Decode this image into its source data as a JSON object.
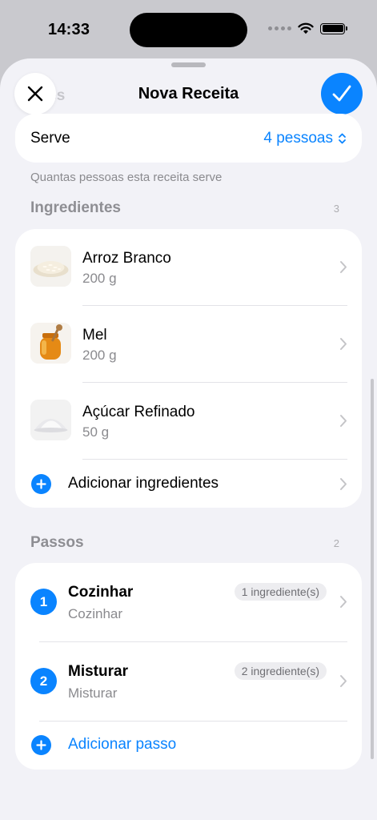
{
  "status_bar": {
    "time": "14:33"
  },
  "sheet": {
    "behind_title": "ções",
    "title": "Nova Receita"
  },
  "serve": {
    "label": "Serve",
    "value": "4 pessoas",
    "footnote": "Quantas pessoas esta receita serve"
  },
  "ingredients": {
    "title": "Ingredientes",
    "count": "3",
    "items": [
      {
        "name": "Arroz Branco",
        "amount": "200 g",
        "icon": "rice-image"
      },
      {
        "name": "Mel",
        "amount": "200 g",
        "icon": "honey-jar-image"
      },
      {
        "name": "Açúcar Refinado",
        "amount": "50 g",
        "icon": "sugar-image"
      }
    ],
    "add_label": "Adicionar ingredientes"
  },
  "steps": {
    "title": "Passos",
    "count": "2",
    "items": [
      {
        "number": "1",
        "title": "Cozinhar",
        "subtitle": "Cozinhar",
        "badge": "1 ingrediente(s)"
      },
      {
        "number": "2",
        "title": "Misturar",
        "subtitle": "Misturar",
        "badge": "2 ingrediente(s)"
      }
    ],
    "add_label": "Adicionar passo"
  },
  "colors": {
    "accent": "#0a84ff",
    "background": "#f2f2f7",
    "secondary_text": "#8a8a8e"
  }
}
